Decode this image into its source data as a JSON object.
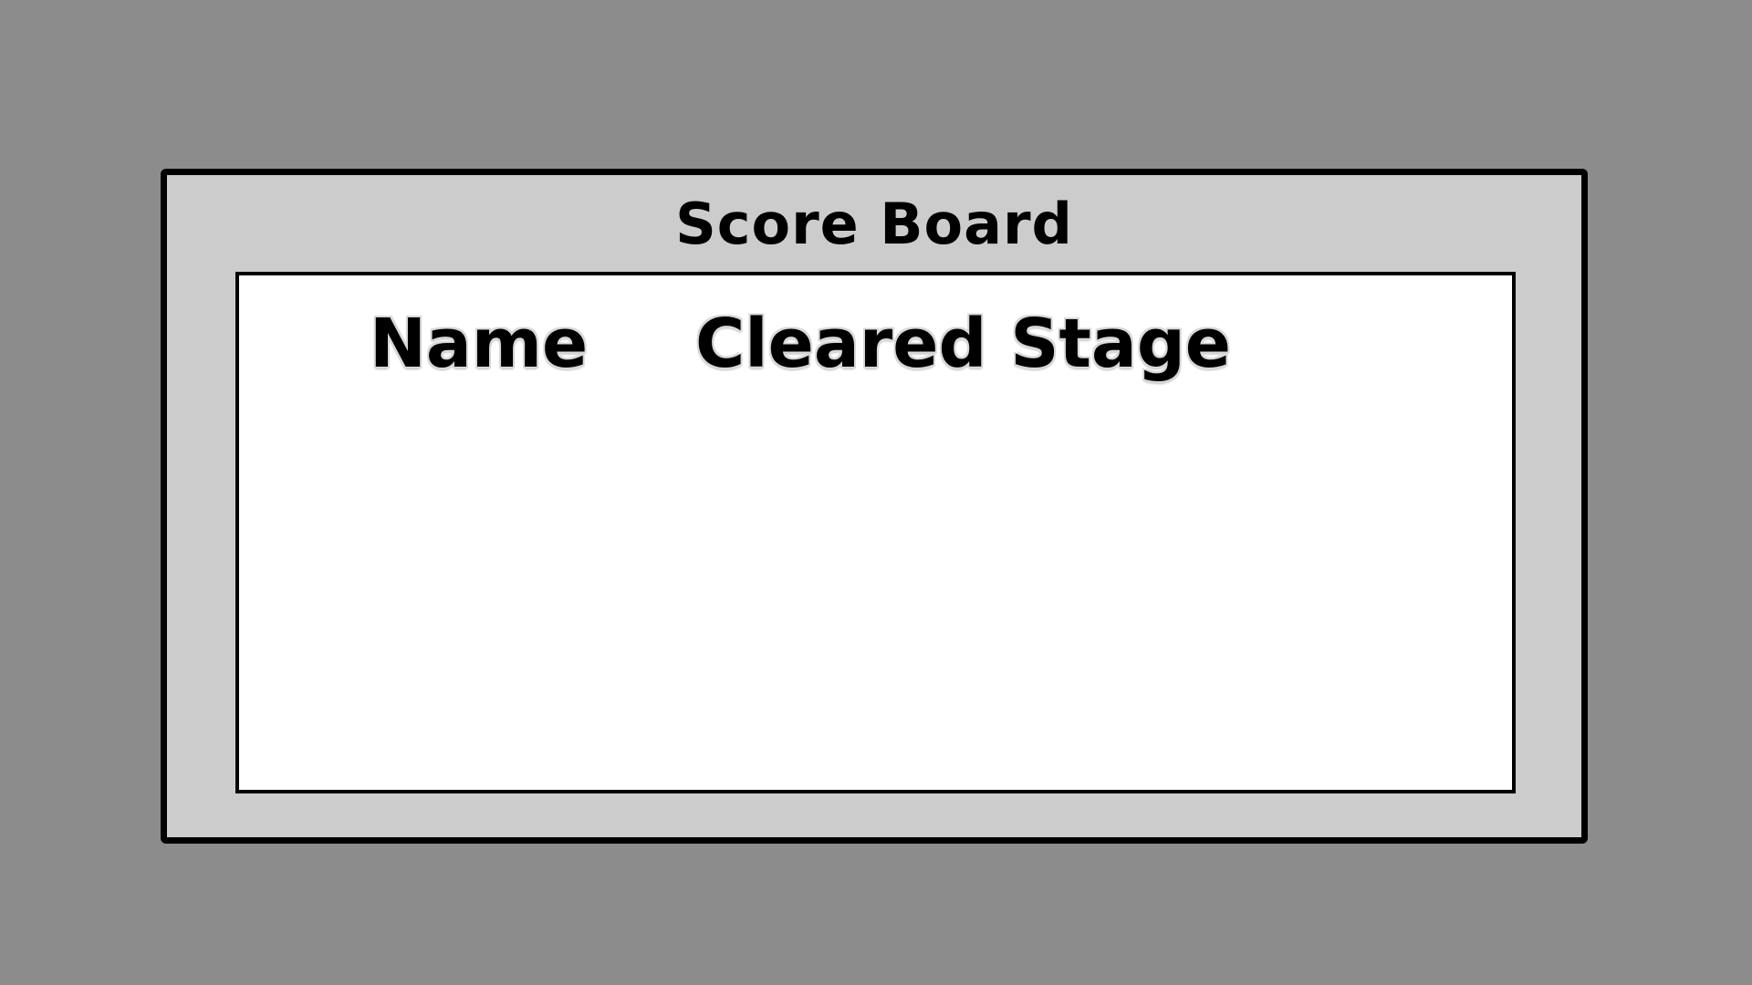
{
  "scoreboard": {
    "title": "Score Board",
    "columns": {
      "name": "Name",
      "cleared_stage": "Cleared Stage"
    },
    "rows": []
  },
  "colors": {
    "background": "#8c8c8c",
    "panel": "#cccccc",
    "table": "#ffffff",
    "border": "#000000"
  }
}
